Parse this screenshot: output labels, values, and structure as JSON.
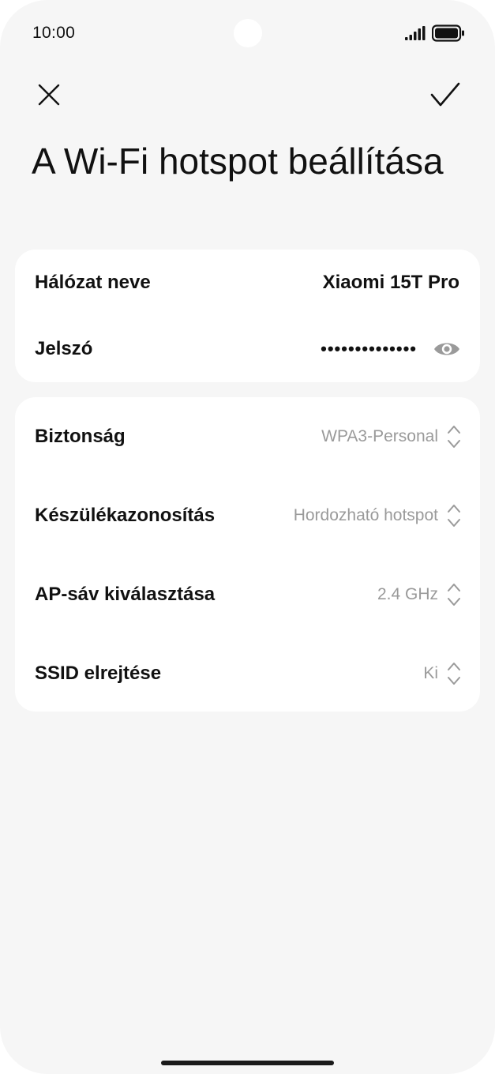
{
  "status_bar": {
    "time": "10:00",
    "signal_icon": "signal-bars-icon",
    "battery_icon": "battery-full-icon"
  },
  "header": {
    "close_icon": "close-icon",
    "confirm_icon": "checkmark-icon",
    "title": "A Wi-Fi hotspot beállítása"
  },
  "network": {
    "name_label": "Hálózat neve",
    "name_value": "Xiaomi 15T Pro",
    "password_label": "Jelszó",
    "password_value": "••••••••••••••",
    "show_password_icon": "eye-icon"
  },
  "settings": [
    {
      "label": "Biztonság",
      "value": "WPA3-Personal",
      "icon": "chevron-updown-icon"
    },
    {
      "label": "Készülékazonosítás",
      "value": "Hordozható hotspot",
      "icon": "chevron-updown-icon"
    },
    {
      "label": "AP-sáv kiválasztása",
      "value": "2.4 GHz",
      "icon": "chevron-updown-icon"
    },
    {
      "label": "SSID elrejtése",
      "value": "Ki",
      "icon": "chevron-updown-icon"
    }
  ],
  "colors": {
    "background": "#f6f6f6",
    "card": "#ffffff",
    "text_primary": "#111111",
    "text_secondary": "#9a9a9a"
  }
}
